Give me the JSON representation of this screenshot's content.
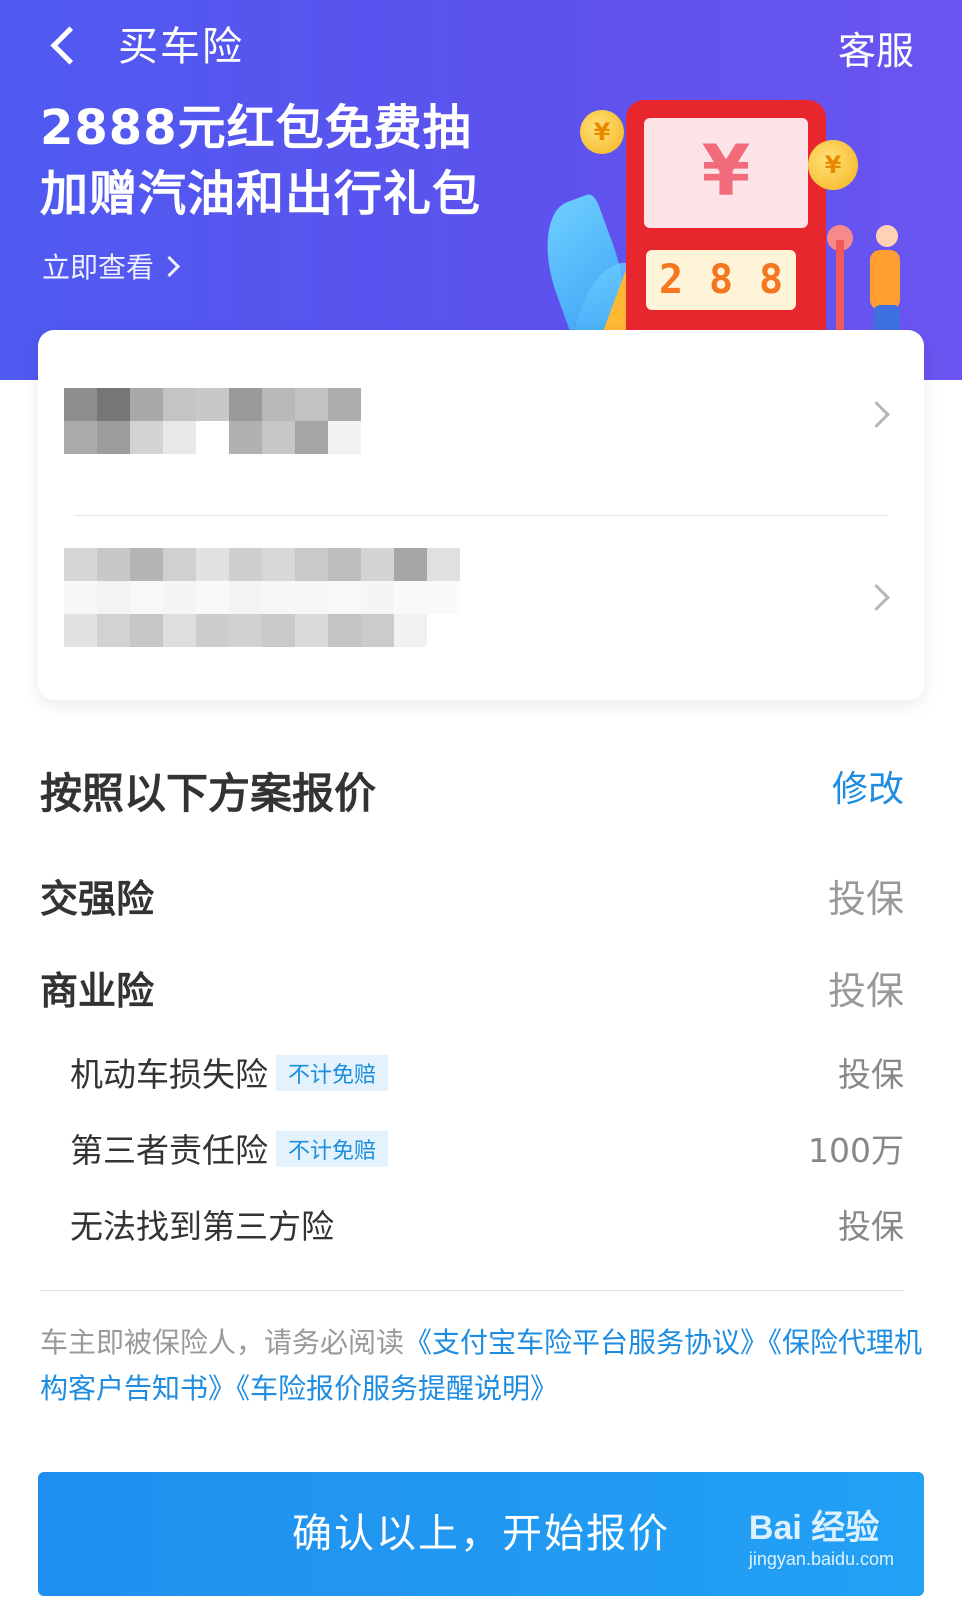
{
  "nav": {
    "title": "买车险",
    "service": "客服"
  },
  "promo": {
    "line1": "2888元红包免费抽",
    "line2": "加赠汽油和出行礼包",
    "link": "立即查看",
    "envelope_symbol": "¥",
    "slot_digits": [
      "2",
      "8",
      "8"
    ]
  },
  "plan": {
    "title": "按照以下方案报价",
    "edit": "修改",
    "main_items": [
      {
        "label": "交强险",
        "value": "投保"
      },
      {
        "label": "商业险",
        "value": "投保"
      }
    ],
    "sub_items": [
      {
        "label": "机动车损失险",
        "tag": "不计免赔",
        "value": "投保"
      },
      {
        "label": "第三者责任险",
        "tag": "不计免赔",
        "value": "100万"
      },
      {
        "label": "无法找到第三方险",
        "tag": "",
        "value": "投保"
      }
    ]
  },
  "agreement": {
    "prefix": "车主即被保险人，请务必阅读",
    "link1": "《支付宝车险平台服务协议》",
    "link2": "《保险代理机构客户告知书》",
    "link3": "《车险报价服务提醒说明》"
  },
  "confirm_button": "确认以上，开始报价",
  "watermark": {
    "top": "Bai 经验",
    "bottom": "jingyan.baidu.com"
  },
  "colors": {
    "banner": "#5656ef",
    "link": "#1e8ce0",
    "button": "#1f8fef",
    "tag_bg": "#e3f2fc"
  }
}
